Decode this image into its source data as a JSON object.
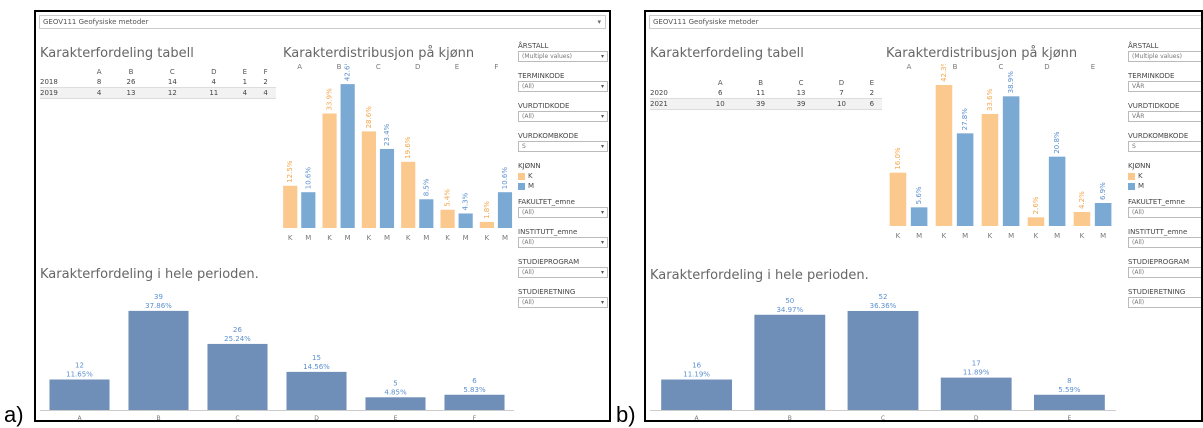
{
  "colors": {
    "female": "#fbc98e",
    "male": "#7aa9d4",
    "total": "#6f8fb8",
    "pct_label_f": "#f5a54a",
    "pct_label_m": "#5b8fcf"
  },
  "panel_labels": [
    "a)",
    "b)"
  ],
  "panels": [
    {
      "header": "GEOV111 Geofysiske metoder",
      "table_title": "Karakterfordeling tabell",
      "table": {
        "columns": [
          "A",
          "B",
          "C",
          "D",
          "E",
          "F"
        ],
        "rows": [
          {
            "year": "2018",
            "values": [
              "8",
              "26",
              "14",
              "4",
              "1",
              "2"
            ]
          },
          {
            "year": "2019",
            "values": [
              "4",
              "13",
              "12",
              "11",
              "4",
              "4"
            ]
          }
        ]
      },
      "gender_title": "Karakterdistribusjon på kjønn",
      "overall_title": "Karakterfordeling i hele perioden.",
      "filters": {
        "items": [
          {
            "label": "ÅRSTALL",
            "value": "(Multiple values)"
          },
          {
            "label": "TERMINKODE",
            "value": "(All)"
          },
          {
            "label": "VURDTIDKODE",
            "value": "(All)"
          },
          {
            "label": "VURDKOMBKODE",
            "value": "S"
          },
          {
            "label": "__legend__",
            "value": ""
          },
          {
            "label": "FAKULTET_emne",
            "value": "(All)"
          },
          {
            "label": "INSTITUTT_emne",
            "value": "(All)"
          },
          {
            "label": "STUDIEPROGRAM",
            "value": "(All)"
          },
          {
            "label": "STUDIERETNING",
            "value": "(All)"
          }
        ],
        "legend_title": "KJØNN",
        "legend_k": "K",
        "legend_m": "M"
      },
      "chart_data": [
        {
          "type": "bar",
          "title": "Karakterdistribusjon på kjønn",
          "categories": [
            "A",
            "B",
            "C",
            "D",
            "E",
            "F"
          ],
          "x_sub": [
            "K",
            "M"
          ],
          "series": [
            {
              "name": "K",
              "values": [
                12.5,
                33.9,
                28.6,
                19.6,
                5.4,
                1.8
              ],
              "labels": [
                "12.5%",
                "33.9%",
                "28.6%",
                "19.6%",
                "5.4%",
                "1.8%"
              ]
            },
            {
              "name": "M",
              "values": [
                10.6,
                42.6,
                23.4,
                8.5,
                4.3,
                10.6
              ],
              "labels": [
                "10.6%",
                "42.6%",
                "23.4%",
                "8.5%",
                "4.3%",
                "10.6%"
              ]
            }
          ],
          "ylim": [
            0,
            45
          ]
        },
        {
          "type": "bar",
          "title": "Karakterfordeling i hele perioden.",
          "categories": [
            "A",
            "B",
            "C",
            "D",
            "E",
            "F"
          ],
          "values": [
            12,
            39,
            26,
            15,
            5,
            6
          ],
          "pct": [
            "11.65%",
            "37.86%",
            "25.24%",
            "14.56%",
            "4.85%",
            "5.83%"
          ],
          "ylim": [
            0,
            40
          ]
        }
      ]
    },
    {
      "header": "GEOV111 Geofysiske metoder",
      "table_title": "Karakterfordeling tabell",
      "table": {
        "columns": [
          "A",
          "B",
          "C",
          "D",
          "E"
        ],
        "rows": [
          {
            "year": "2020",
            "values": [
              "6",
              "11",
              "13",
              "7",
              "2"
            ]
          },
          {
            "year": "2021",
            "values": [
              "10",
              "39",
              "39",
              "10",
              "6"
            ]
          }
        ]
      },
      "gender_title": "Karakterdistribusjon på kjønn",
      "overall_title": "Karakterfordeling i hele perioden.",
      "filters": {
        "items": [
          {
            "label": "ÅRSTALL",
            "value": "(Multiple values)"
          },
          {
            "label": "TERMINKODE",
            "value": "VÅR"
          },
          {
            "label": "VURDTIDKODE",
            "value": "VÅR"
          },
          {
            "label": "VURDKOMBKODE",
            "value": "S"
          },
          {
            "label": "__legend__",
            "value": ""
          },
          {
            "label": "FAKULTET_emne",
            "value": "(All)"
          },
          {
            "label": "INSTITUTT_emne",
            "value": "(All)"
          },
          {
            "label": "STUDIEPROGRAM",
            "value": "(All)"
          },
          {
            "label": "STUDIERETNING",
            "value": "(All)"
          }
        ],
        "legend_title": "KJØNN",
        "legend_k": "K",
        "legend_m": "M"
      },
      "chart_data": [
        {
          "type": "bar",
          "title": "Karakterdistribusjon på kjønn",
          "categories": [
            "A",
            "B",
            "C",
            "D",
            "E"
          ],
          "x_sub": [
            "K",
            "M"
          ],
          "series": [
            {
              "name": "K",
              "values": [
                16.0,
                42.3,
                33.6,
                2.6,
                4.2
              ],
              "labels": [
                "16.0%",
                "42.3%",
                "33.6%",
                "2.6%",
                "4.2%"
              ]
            },
            {
              "name": "M",
              "values": [
                5.6,
                27.8,
                38.9,
                20.8,
                6.9
              ],
              "labels": [
                "5.6%",
                "27.8%",
                "38.9%",
                "20.8%",
                "6.9%"
              ]
            }
          ],
          "ylim": [
            0,
            45
          ]
        },
        {
          "type": "bar",
          "title": "Karakterfordeling i hele perioden.",
          "categories": [
            "A",
            "B",
            "C",
            "D",
            "E"
          ],
          "values": [
            16,
            50,
            52,
            17,
            8
          ],
          "pct": [
            "11.19%",
            "34.97%",
            "36.36%",
            "11.89%",
            "5.59%"
          ],
          "ylim": [
            0,
            55
          ]
        }
      ]
    }
  ]
}
